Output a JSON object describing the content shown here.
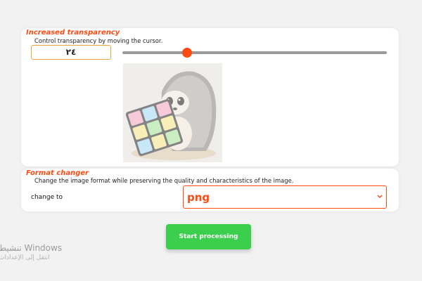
{
  "transparency": {
    "title": "Increased transparency",
    "description": "Control transparency by moving the cursor.",
    "value": "٢٤",
    "slider_fraction": 0.245,
    "accent_color": "#ff4a12"
  },
  "image": {
    "subject": "hedgehog holding a rubik's cube",
    "icon": "preview-image"
  },
  "format": {
    "title": "Format changer",
    "description": "Change the image format while preserving the quality and characteristics of the image.",
    "label": "change to",
    "selected": "png"
  },
  "action": {
    "button_label": "Start processing",
    "button_color": "#3ccf4e"
  },
  "watermark": {
    "line1": "تنشيط Windows",
    "line2": "انتقل إلى الإعدادات"
  }
}
